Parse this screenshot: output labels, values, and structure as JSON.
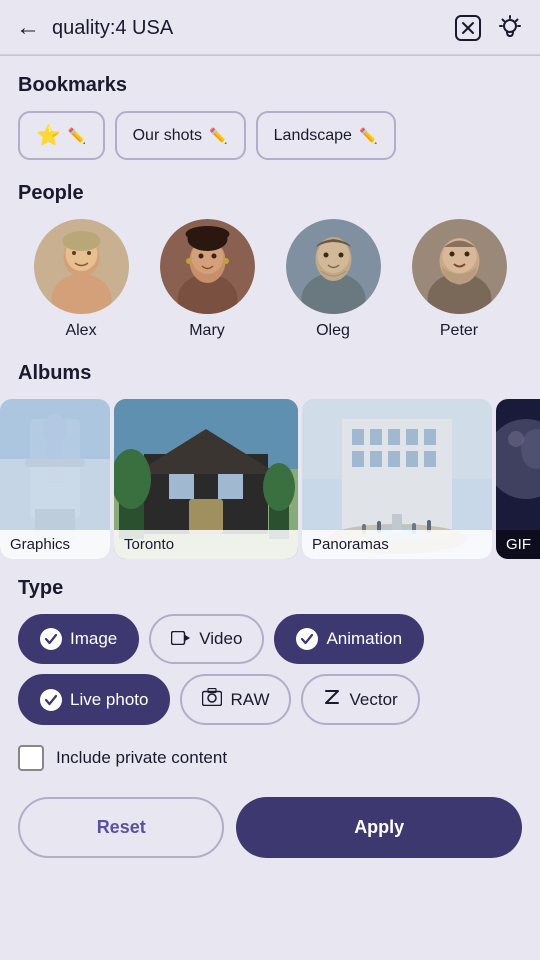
{
  "header": {
    "title": "quality:4 USA",
    "back_label": "←",
    "clear_icon": "clear-search-icon",
    "bulb_icon": "bulb-icon"
  },
  "bookmarks": {
    "section_title": "Bookmarks",
    "items": [
      {
        "id": "star",
        "label": "",
        "has_star": true
      },
      {
        "id": "our-shots",
        "label": "Our shots"
      },
      {
        "id": "landscape",
        "label": "Landscape"
      }
    ]
  },
  "people": {
    "section_title": "People",
    "items": [
      {
        "name": "Alex"
      },
      {
        "name": "Mary"
      },
      {
        "name": "Oleg"
      },
      {
        "name": "Peter"
      }
    ]
  },
  "albums": {
    "section_title": "Albums",
    "items": [
      {
        "label": "Graphics",
        "theme": "graphics"
      },
      {
        "label": "Toronto",
        "theme": "toronto"
      },
      {
        "label": "Panoramas",
        "theme": "panoramas"
      },
      {
        "label": "GIF",
        "theme": "gif"
      }
    ]
  },
  "type": {
    "section_title": "Type",
    "items": [
      {
        "id": "image",
        "label": "Image",
        "selected": true,
        "icon": "✓"
      },
      {
        "id": "video",
        "label": "Video",
        "selected": false,
        "icon": "▶"
      },
      {
        "id": "animation",
        "label": "Animation",
        "selected": true,
        "icon": "✓"
      },
      {
        "id": "live-photo",
        "label": "Live photo",
        "selected": true,
        "icon": "✓"
      },
      {
        "id": "raw",
        "label": "RAW",
        "selected": false,
        "icon": "□"
      },
      {
        "id": "vector",
        "label": "Vector",
        "selected": false,
        "icon": "Z"
      }
    ]
  },
  "private": {
    "label": "Include private content",
    "checked": false
  },
  "buttons": {
    "reset_label": "Reset",
    "apply_label": "Apply"
  },
  "avatars": {
    "alex_color": "#c8a87a",
    "mary_color": "#6a4a3a",
    "oleg_color": "#8a9aaa",
    "peter_color": "#9a8878"
  }
}
